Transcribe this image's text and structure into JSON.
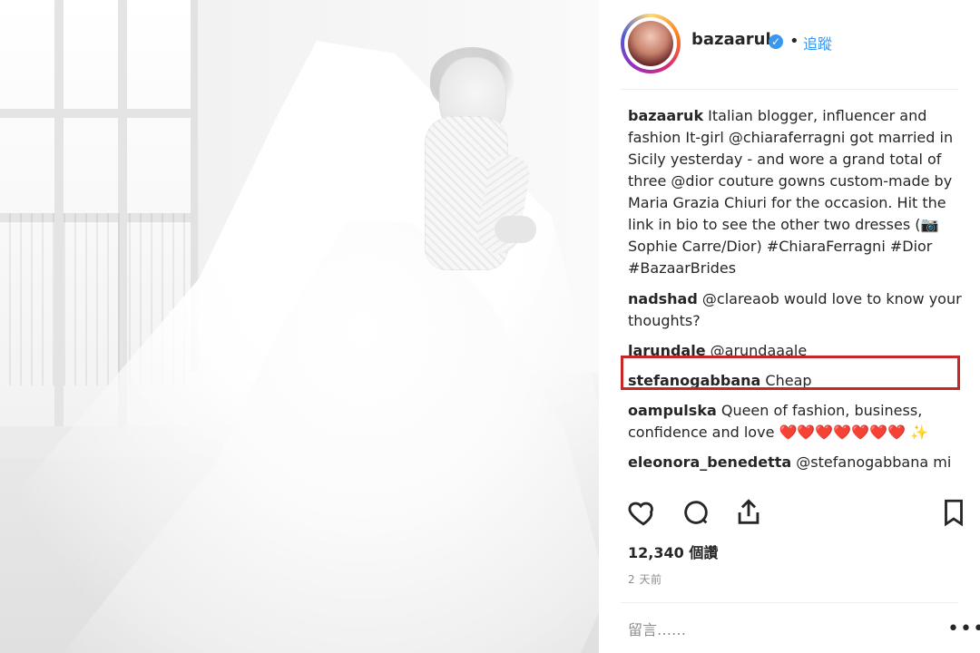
{
  "post": {
    "username": "bazaaruk",
    "follow_label": "追蹤",
    "caption": {
      "username": "bazaaruk",
      "text": "Italian blogger, influencer and fashion It-girl @chiaraferragni got married in Sicily yesterday - and wore a grand total of three @dior couture gowns custom-made by Maria Grazia Chiuri for the occasion. Hit the link in bio to see the other two dresses (📷 Sophie Carre/Dior) #ChiaraFerragni #Dior #BazaarBrides"
    },
    "comments": [
      {
        "username": "nadshad",
        "text": "@clareaob would love to know your thoughts?"
      },
      {
        "username": "larundale",
        "text": "@arundaaale"
      },
      {
        "username": "stefanogabbana",
        "text": "Cheap"
      },
      {
        "username": "oampulska",
        "text": "Queen of fashion, business, confidence and love ❤️❤️❤️❤️❤️❤️❤️ ✨"
      },
      {
        "username": "eleonora_benedetta",
        "text": "@stefanogabbana mi"
      }
    ],
    "likes_text": "12,340 個讚",
    "time_text": "2 天前",
    "comment_placeholder": "留言……",
    "more_label": "•••",
    "icons": {
      "like": "heart-icon",
      "comment": "comment-icon",
      "share": "share-icon",
      "save": "bookmark-icon"
    },
    "colors": {
      "accent": "#3897f0",
      "highlight_border": "#c62828",
      "muted": "#8e8e8e"
    }
  }
}
